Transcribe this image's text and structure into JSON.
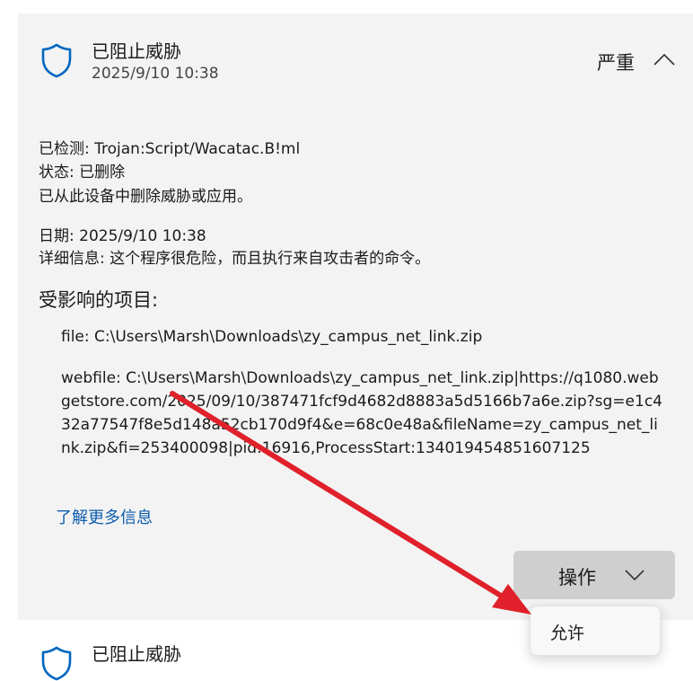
{
  "threat": {
    "title": "已阻止威胁",
    "datetime": "2025/9/10 10:38",
    "severity": "严重",
    "shield_icon": "shield-icon",
    "collapse_icon": "chevron-up-icon"
  },
  "details": {
    "detected": "已检测:  Trojan:Script/Wacatac.B!ml",
    "status": "状态:  已删除",
    "removed_msg": "已从此设备中删除威胁或应用。",
    "date": "日期:  2025/9/10 10:38",
    "info": "详细信息:  这个程序很危险，而且执行来自攻击者的命令。"
  },
  "affected": {
    "heading": "受影响的项目:",
    "file": "file: C:\\Users\\Marsh\\Downloads\\zy_campus_net_link.zip",
    "webfile": "webfile: C:\\Users\\Marsh\\Downloads\\zy_campus_net_link.zip|https://q1080.webgetstore.com/2025/09/10/387471fcf9d4682d8883a5d5166b7a6e.zip?sg=e1c432a77547f8e5d148a52cb170d9f4&e=68c0e48a&fileName=zy_campus_net_link.zip&fi=253400098|pid:16916,ProcessStart:134019454851607125"
  },
  "learn_more": "了解更多信息",
  "actions": {
    "label": "操作",
    "chevron_icon": "chevron-down-icon",
    "menu_items": [
      "允许"
    ]
  },
  "next_item": {
    "title": "已阻止威胁"
  },
  "colors": {
    "panel_bg": "#f3f3f3",
    "link": "#0b5cad",
    "shield": "#0067c0",
    "arrow": "#e0202a",
    "button_bg": "#cfcfcf"
  }
}
